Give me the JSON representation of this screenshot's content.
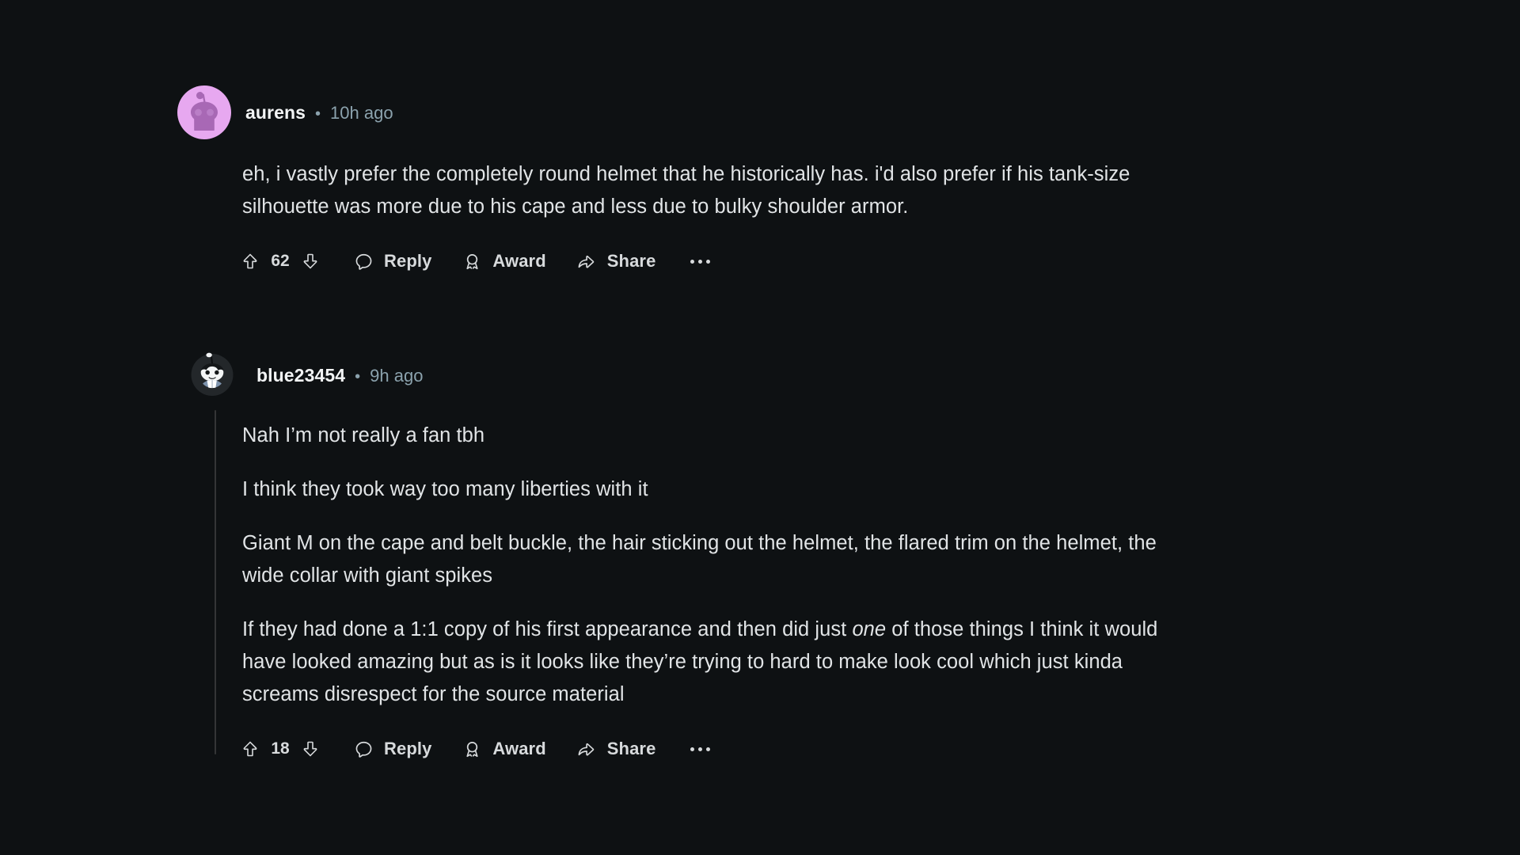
{
  "theme": {
    "background": "#0e1113",
    "body_text": "#e1e4e6",
    "username_text": "#f2f4f5",
    "meta_text": "#8ba2ad",
    "action_text": "#d7dadc",
    "thread_line": "#343536"
  },
  "comments": [
    {
      "id": "comment-1",
      "author": "aurens",
      "separator": "•",
      "timestamp": "10h ago",
      "avatar": {
        "name": "avatar-aurens",
        "type": "snoo",
        "background": "#e7a8f0",
        "figure": "#a868b5",
        "antenna": "#a868b5"
      },
      "paragraphs": [
        "eh, i vastly prefer the completely round helmet that he historically has. i'd also prefer if his tank-size silhouette was more due to his cape and less due to bulky shoulder armor."
      ],
      "actions": {
        "upvote_icon": "upvote-arrow-icon",
        "vote_count": "62",
        "downvote_icon": "downvote-arrow-icon",
        "reply_icon": "comment-bubble-icon",
        "reply_label": "Reply",
        "award_icon": "award-medal-icon",
        "award_label": "Award",
        "share_icon": "share-arrow-icon",
        "share_label": "Share",
        "overflow_icon": "overflow-dots-icon"
      },
      "nested": false
    },
    {
      "id": "comment-2",
      "author": "blue23454",
      "separator": "•",
      "timestamp": "9h ago",
      "avatar": {
        "name": "avatar-blue23454",
        "type": "snoo",
        "background": "#23272a",
        "figure": "#ffffff",
        "hair": "#101214",
        "body": "#7d93ad"
      },
      "paragraphs": [
        "Nah I’m not really a fan tbh",
        "I think they took way too many liberties with it",
        "Giant M on the cape and belt buckle, the hair sticking out the helmet, the flared trim on the helmet, the wide collar with giant spikes"
      ],
      "last_paragraph": {
        "before": "If they had done a 1:1 copy of his first appearance and then did just ",
        "emphasis": "one",
        "after": " of those things I think it would have looked amazing but as is it looks like they’re trying to hard to make look cool which just kinda screams disrespect for the source material"
      },
      "actions": {
        "upvote_icon": "upvote-arrow-icon",
        "vote_count": "18",
        "downvote_icon": "downvote-arrow-icon",
        "reply_icon": "comment-bubble-icon",
        "reply_label": "Reply",
        "award_icon": "award-medal-icon",
        "award_label": "Award",
        "share_icon": "share-arrow-icon",
        "share_label": "Share",
        "overflow_icon": "overflow-dots-icon"
      },
      "nested": true
    }
  ]
}
